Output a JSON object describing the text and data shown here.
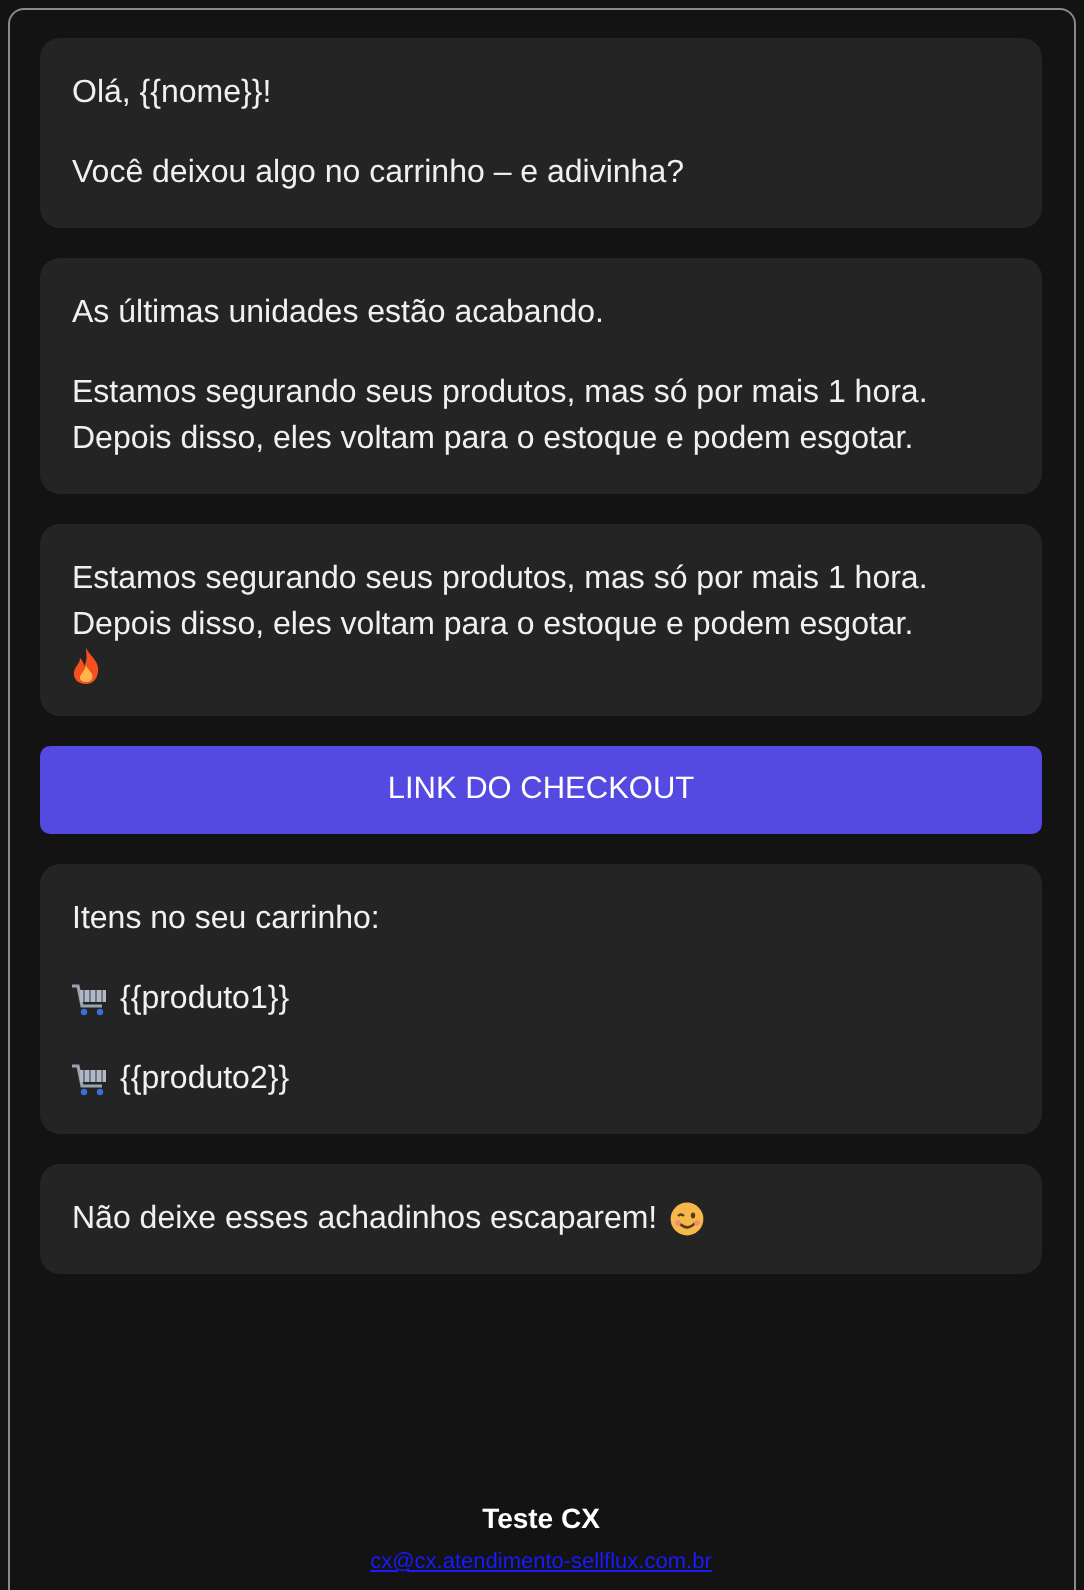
{
  "blocks": [
    {
      "kind": "message",
      "paragraphs": [
        {
          "text": "Olá, {{nome}}!"
        },
        {
          "text": "Você deixou algo no carrinho – e adivinha?"
        }
      ]
    },
    {
      "kind": "message",
      "paragraphs": [
        {
          "text": "As últimas unidades estão acabando."
        },
        {
          "text": "Estamos segurando seus produtos, mas só por mais 1 hora. Depois disso, eles voltam para o estoque e podem esgotar."
        }
      ]
    },
    {
      "kind": "message",
      "paragraphs": [
        {
          "text": "Estamos segurando seus produtos, mas só por mais 1 hora. Depois disso, eles voltam para o estoque e podem esgotar.",
          "kind": "flame"
        }
      ]
    },
    {
      "kind": "button",
      "label": "LINK DO CHECKOUT"
    },
    {
      "kind": "message",
      "paragraphs": [
        {
          "text": "Itens no seu carrinho:"
        },
        {
          "text": "{{produto1}}",
          "kind": "cart-item"
        },
        {
          "text": "{{produto2}}",
          "kind": "cart-item"
        }
      ]
    },
    {
      "kind": "message",
      "paragraphs": [
        {
          "text": "Não deixe esses achadinhos escaparem!",
          "kind": "wink"
        }
      ]
    }
  ],
  "footer": {
    "name": "Teste CX",
    "email": "cx@cx.atendimento-sellflux.com.br"
  }
}
